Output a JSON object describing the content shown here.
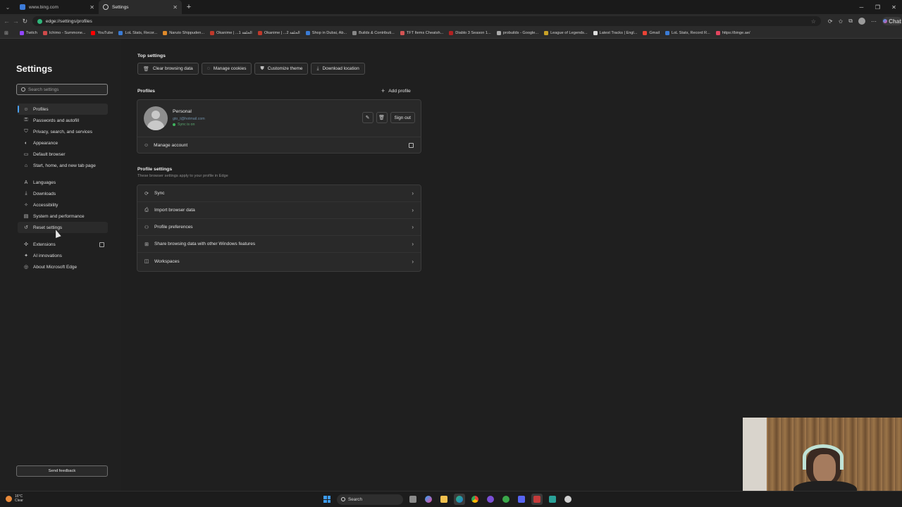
{
  "browser": {
    "tabs": [
      {
        "title": "www.bing.com",
        "active": false
      },
      {
        "title": "Settings",
        "active": true
      }
    ],
    "url": "edge://settings/profiles",
    "copilot_label": "Chat",
    "bookmarks": [
      {
        "label": "Twitch",
        "color": "#9146ff"
      },
      {
        "label": "Ichimo - Summone...",
        "color": "#d04a4a"
      },
      {
        "label": "YouTube",
        "color": "#ff0000"
      },
      {
        "label": "LoL Stats, Recor...",
        "color": "#3a7bd5"
      },
      {
        "label": "Naruto Shippuden...",
        "color": "#e08a2a"
      },
      {
        "label": "Okanime | ...1 الحلقة",
        "color": "#c0392b"
      },
      {
        "label": "Okanime | ...2 الحلقة",
        "color": "#c0392b"
      },
      {
        "label": "Shop in Dubai, Ab...",
        "color": "#3a7bd5"
      },
      {
        "label": "Builds & Contributi...",
        "color": "#888888"
      },
      {
        "label": "TFT Items Cheatsh...",
        "color": "#d35454"
      },
      {
        "label": "Diablo 3 Season 1...",
        "color": "#b22222"
      },
      {
        "label": "probuilds - Google...",
        "color": "#aaaaaa"
      },
      {
        "label": "League of Legends...",
        "color": "#c9a227"
      },
      {
        "label": "Latest Tracks | Engl...",
        "color": "#dddddd"
      },
      {
        "label": "Gmail",
        "color": "#ea4335"
      },
      {
        "label": "LoL Stats, Record R...",
        "color": "#3a7bd5"
      },
      {
        "label": "https://binge.ae/",
        "color": "#e2455f"
      }
    ]
  },
  "sidebar": {
    "title": "Settings",
    "search_placeholder": "Search settings",
    "items": [
      {
        "label": "Profiles",
        "icon": "person-icon"
      },
      {
        "label": "Passwords and autofill",
        "icon": "key-icon"
      },
      {
        "label": "Privacy, search, and services",
        "icon": "lock-icon"
      },
      {
        "label": "Appearance",
        "icon": "palette-icon"
      },
      {
        "label": "Default browser",
        "icon": "browser-icon"
      },
      {
        "label": "Start, home, and new tab page",
        "icon": "home-icon"
      },
      {
        "label": "Languages",
        "icon": "language-icon"
      },
      {
        "label": "Downloads",
        "icon": "download-icon"
      },
      {
        "label": "Accessibility",
        "icon": "accessibility-icon"
      },
      {
        "label": "System and performance",
        "icon": "system-icon"
      },
      {
        "label": "Reset settings",
        "icon": "reset-icon"
      },
      {
        "label": "Extensions",
        "icon": "puzzle-icon"
      },
      {
        "label": "AI innovations",
        "icon": "sparkle-icon"
      },
      {
        "label": "About Microsoft Edge",
        "icon": "edge-icon"
      }
    ],
    "feedback_label": "Send feedback"
  },
  "main": {
    "top_settings_title": "Top settings",
    "top_settings": [
      {
        "label": "Clear browsing data",
        "icon": "trash-icon"
      },
      {
        "label": "Manage cookies",
        "icon": "cookie-icon"
      },
      {
        "label": "Customize theme",
        "icon": "brush-icon"
      },
      {
        "label": "Download location",
        "icon": "download-icon"
      }
    ],
    "profiles_title": "Profiles",
    "add_profile_label": "Add profile",
    "profile": {
      "name": "Personal",
      "email": "gto_t@hotmail.com",
      "sync_status": "Sync is on",
      "sign_out_label": "Sign out",
      "manage_account_label": "Manage account"
    },
    "profile_settings_title": "Profile settings",
    "profile_settings_subtitle": "These browser settings apply to your profile in Edge",
    "profile_settings": [
      {
        "label": "Sync",
        "icon": "sync-icon"
      },
      {
        "label": "Import browser data",
        "icon": "import-icon"
      },
      {
        "label": "Profile preferences",
        "icon": "profile-prefs-icon"
      },
      {
        "label": "Share browsing data with other Windows features",
        "icon": "windows-icon"
      },
      {
        "label": "Workspaces",
        "icon": "workspaces-icon"
      }
    ]
  },
  "taskbar": {
    "weather_temp": "16°C",
    "weather_desc": "Clear",
    "search_label": "Search"
  },
  "colors": {
    "accent": "#4aa0f0",
    "background": "#1f1f1f",
    "card": "#292929"
  }
}
